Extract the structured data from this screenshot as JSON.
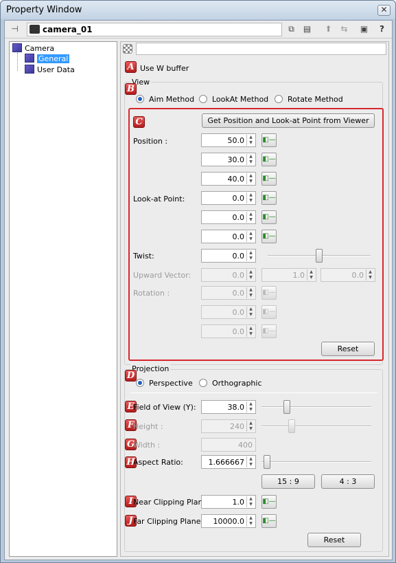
{
  "window": {
    "title": "Property Window",
    "close_glyph": "✕"
  },
  "toolbar": {
    "object_name": "camera_01"
  },
  "tree": {
    "root": "Camera",
    "children": [
      "General",
      "User Data"
    ],
    "selected": "General"
  },
  "markers": [
    "A",
    "B",
    "C",
    "D",
    "E",
    "F",
    "G",
    "H",
    "I",
    "J"
  ],
  "panel": {
    "use_w_buffer": {
      "label": "Use W buffer",
      "checked": false
    },
    "view": {
      "title": "View",
      "methods": [
        "Aim Method",
        "LookAt Method",
        "Rotate Method"
      ],
      "selected_method": "Aim Method",
      "get_button": "Get Position and Look-at Point from Viewer",
      "position_label": "Position :",
      "position": [
        "50.0",
        "30.0",
        "40.0"
      ],
      "lookat_label": "Look-at Point:",
      "lookat": [
        "0.0",
        "0.0",
        "0.0"
      ],
      "twist_label": "Twist:",
      "twist": "0.0",
      "twist_slider_fraction": 0.5,
      "upward_label": "Upward Vector:",
      "upward": [
        "0.0",
        "1.0",
        "0.0"
      ],
      "rotation_label": "Rotation :",
      "rotation": [
        "0.0",
        "0.0",
        "0.0"
      ],
      "reset": "Reset"
    },
    "projection": {
      "title": "Projection",
      "modes": [
        "Perspective",
        "Orthographic"
      ],
      "selected_mode": "Perspective",
      "fov_label": "Field of View (Y):",
      "fov": "38.0",
      "fov_slider_fraction": 0.21,
      "height_label": "Height :",
      "height": "240",
      "height_slider_fraction": 0.26,
      "width_label": "Width :",
      "width": "400",
      "aspect_label": "Aspect Ratio:",
      "aspect": "1.666667",
      "aspect_slider_fraction": 0.02,
      "ratio_buttons": [
        "15 : 9",
        "4 : 3"
      ],
      "near_label": "Near Clipping Plane:",
      "near": "1.0",
      "far_label": "Far Clipping Plane:",
      "far": "10000.0",
      "reset": "Reset"
    }
  },
  "colors": {
    "highlight_box": "#d8262e",
    "marker": "#c42323",
    "selection": "#3399ff"
  }
}
